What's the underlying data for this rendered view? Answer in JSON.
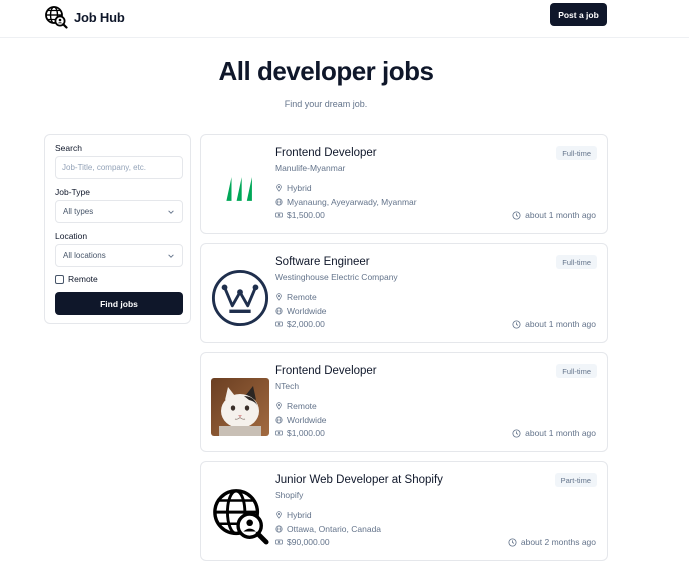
{
  "navbar": {
    "brand_text": "Job Hub",
    "post_button": "Post a job"
  },
  "header": {
    "title": "All developer jobs",
    "subtitle": "Find your dream job."
  },
  "filters": {
    "search_label": "Search",
    "search_placeholder": "Job-Title, company, etc.",
    "search_value": "",
    "type_label": "Job-Type",
    "type_value": "All types",
    "location_label": "Location",
    "location_value": "All locations",
    "remote_label": "Remote",
    "remote_checked": false,
    "find_button": "Find jobs"
  },
  "jobs": [
    {
      "title": "Frontend Developer",
      "company": "Manulife-Myanmar",
      "type": "Full-time",
      "work_mode": "Hybrid",
      "location": "Myanaung, Ayeyarwady, Myanmar",
      "salary": "$1,500.00",
      "posted": "about 1 month ago",
      "logo": "manulife-logo",
      "logo_color": "#00a758"
    },
    {
      "title": "Software Engineer",
      "company": "Westinghouse Electric Company",
      "type": "Full-time",
      "work_mode": "Remote",
      "location": "Worldwide",
      "salary": "$2,000.00",
      "posted": "about 1 month ago",
      "logo": "westinghouse-logo",
      "logo_color": "#1f2f4d"
    },
    {
      "title": "Frontend Developer",
      "company": "NTech",
      "type": "Full-time",
      "work_mode": "Remote",
      "location": "Worldwide",
      "salary": "$1,000.00",
      "posted": "about 1 month ago",
      "logo": "cat-photo-logo",
      "logo_color": "#8a5a36"
    },
    {
      "title": "Junior Web Developer at Shopify",
      "company": "Shopify",
      "type": "Part-time",
      "work_mode": "Hybrid",
      "location": "Ottawa, Ontario, Canada",
      "salary": "$90,000.00",
      "posted": "about 2 months ago",
      "logo": "globe-search-logo",
      "logo_color": "#000000"
    }
  ]
}
